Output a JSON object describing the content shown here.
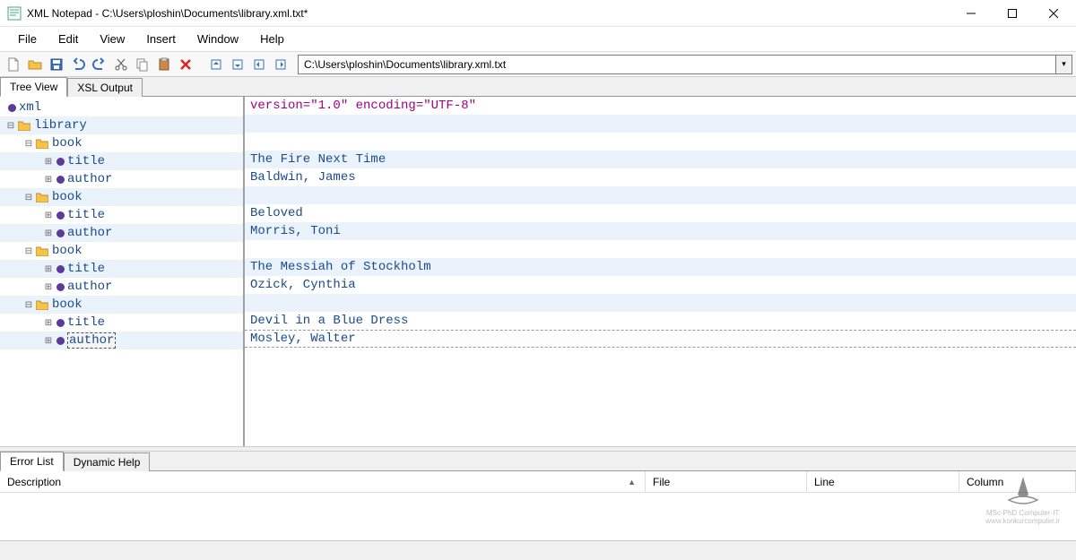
{
  "window": {
    "title": "XML Notepad - C:\\Users\\ploshin\\Documents\\library.xml.txt*"
  },
  "menubar": [
    "File",
    "Edit",
    "View",
    "Insert",
    "Window",
    "Help"
  ],
  "toolbar": {
    "path": "C:\\Users\\ploshin\\Documents\\library.xml.txt"
  },
  "main_tabs": {
    "tree_view": "Tree View",
    "xsl_output": "XSL Output"
  },
  "tree": {
    "xml": "xml",
    "library": "library",
    "book": "book",
    "title": "title",
    "author": "author"
  },
  "values": {
    "xml_decl": "version=\"1.0\" encoding=\"UTF-8\"",
    "books": [
      {
        "title": "The Fire Next Time",
        "author": "Baldwin, James"
      },
      {
        "title": "Beloved",
        "author": "Morris, Toni"
      },
      {
        "title": "The Messiah of Stockholm",
        "author": "Ozick, Cynthia"
      },
      {
        "title": "Devil in a Blue Dress",
        "author": "Mosley, Walter"
      }
    ]
  },
  "bottom_tabs": {
    "error_list": "Error List",
    "dynamic_help": "Dynamic Help"
  },
  "error_columns": {
    "description": "Description",
    "file": "File",
    "line": "Line",
    "column": "Column"
  },
  "watermark": {
    "line1": "MSc-PhD Computer-IT",
    "line2": "www.konkurcomputer.ir"
  }
}
